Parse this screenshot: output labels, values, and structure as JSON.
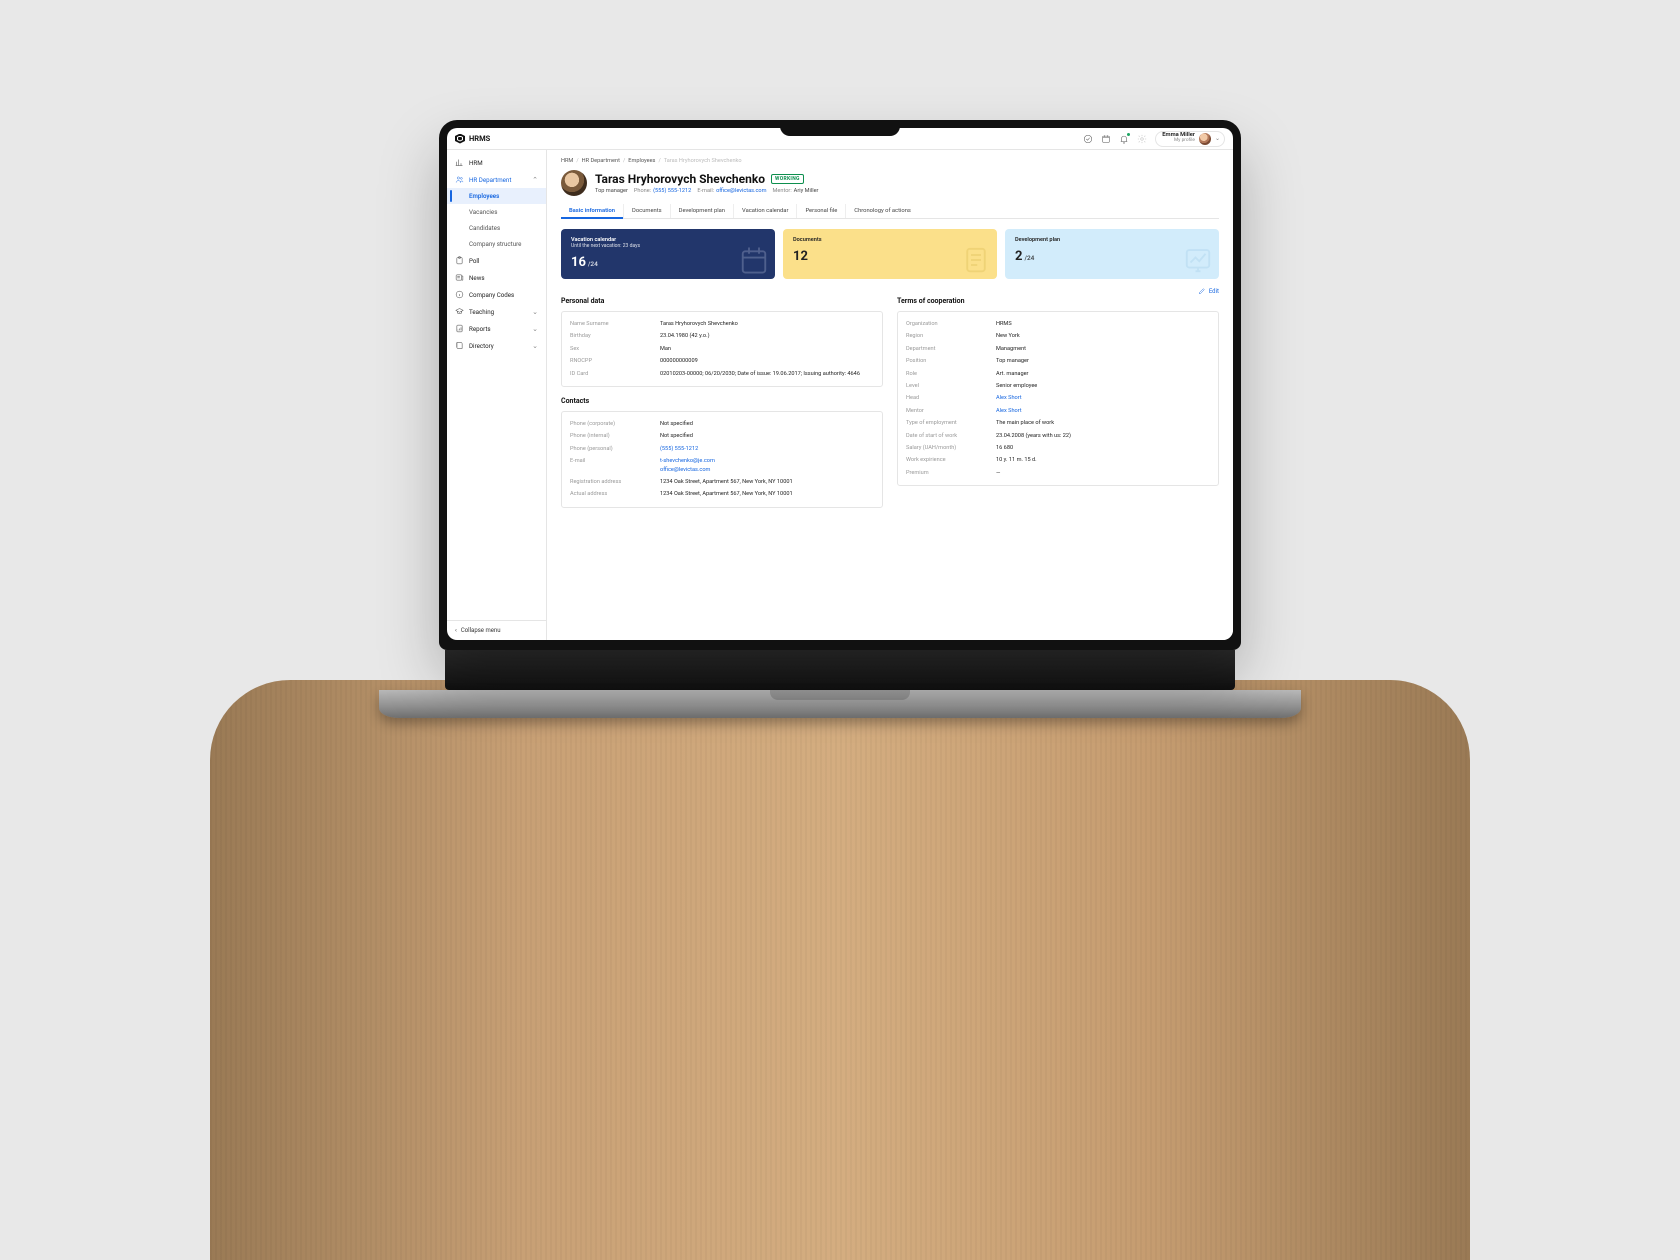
{
  "brand": "HRMS",
  "header": {
    "user_name": "Emma Miller",
    "user_sub": "My profile"
  },
  "sidebar": {
    "items": [
      {
        "label": "HRM"
      },
      {
        "label": "HR Department"
      },
      {
        "label": "Poll"
      },
      {
        "label": "News"
      },
      {
        "label": "Company Codes"
      },
      {
        "label": "Teaching"
      },
      {
        "label": "Reports"
      },
      {
        "label": "Directory"
      }
    ],
    "hr_subs": [
      "Employees",
      "Vacancies",
      "Candidates",
      "Company structure"
    ],
    "collapse": "Collapse menu"
  },
  "crumbs": [
    "HRM",
    "HR Department",
    "Employees",
    "Taras Hryhorovych Shevchenko"
  ],
  "profile": {
    "name": "Taras Hryhorovych Shevchenko",
    "status": "WORKING",
    "position": "Top manager",
    "phone_label": "Phone:",
    "phone": "(555) 555-1212",
    "email_label": "E-mail:",
    "email": "office@levictas.com",
    "mentor_label": "Mentor:",
    "mentor": "Ariy Miller"
  },
  "tabs": [
    "Basic information",
    "Documents",
    "Development plan",
    "Vacation calendar",
    "Personal file",
    "Chronology of actions"
  ],
  "cards": {
    "vacation": {
      "title": "Vacation calendar",
      "subtitle": "Until the next vacation: 23 days",
      "value": "16",
      "denom": "/24"
    },
    "documents": {
      "title": "Documents",
      "value": "12"
    },
    "devplan": {
      "title": "Development plan",
      "value": "2",
      "denom": "/24"
    }
  },
  "edit": "Edit",
  "personal": {
    "title": "Personal data",
    "rows": [
      {
        "k": "Name Surname",
        "v": "Taras Hryhorovych Shevchenko"
      },
      {
        "k": "Birthday",
        "v": "23.04.1980 (42 y.o.)"
      },
      {
        "k": "Sex",
        "v": "Man"
      },
      {
        "k": "RNOCPP",
        "v": "000000000009"
      },
      {
        "k": "ID Card",
        "v": "02010203-00000; 06/20/2030; Date of issue: 19.06.2017; Issuing authority: 4646"
      }
    ]
  },
  "contacts": {
    "title": "Contacts",
    "rows": [
      {
        "k": "Phone (corporate)",
        "v": "Not specified"
      },
      {
        "k": "Phone (internal)",
        "v": "Not specified"
      },
      {
        "k": "Phone (personal)",
        "v": "(555) 555-1212",
        "link": true
      },
      {
        "k": "E-mail",
        "v1": "t-shevchenko@je.com",
        "v2": "office@levictas.com",
        "link": true
      },
      {
        "k": "Registration address",
        "v": "1234 Oak Street, Apartment 567, New York, NY 10001"
      },
      {
        "k": "Actual address",
        "v": "1234 Oak Street, Apartment 567, New York, NY 10001"
      }
    ]
  },
  "terms": {
    "title": "Terms of cooperation",
    "rows": [
      {
        "k": "Organization",
        "v": "HRMS"
      },
      {
        "k": "Region",
        "v": "New York"
      },
      {
        "k": "Department",
        "v": "Managment"
      },
      {
        "k": "Position",
        "v": "Top manager"
      },
      {
        "k": "Role",
        "v": "Art. manager"
      },
      {
        "k": "Level",
        "v": "Senior employee"
      },
      {
        "k": "Head",
        "v": "Alex Short",
        "link": true
      },
      {
        "k": "Mentor",
        "v": "Alex Short",
        "link": true
      },
      {
        "k": "Type of employment",
        "v": "The main place of work"
      },
      {
        "k": "Date of start of work",
        "v": "23.04.2008 (years with us: 22)"
      },
      {
        "k": "Salary (UAH/month)",
        "v": "16 680"
      },
      {
        "k": "Work expirience",
        "v": "10 y. 11 m. 15 d."
      },
      {
        "k": "Premium",
        "v": "—"
      }
    ]
  }
}
